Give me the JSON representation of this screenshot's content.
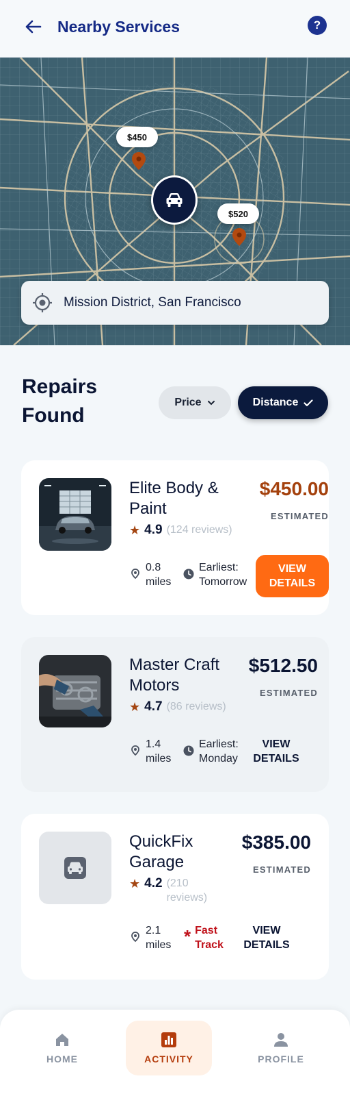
{
  "header": {
    "title": "Nearby Services",
    "back_icon": "arrow-left-icon",
    "help_icon": "question-icon",
    "help_label": "?"
  },
  "map": {
    "pins": [
      {
        "label": "$450"
      },
      {
        "label": "$520"
      }
    ],
    "center_icon": "car-icon",
    "location": "Mission District, San Francisco",
    "location_icon": "crosshair-icon"
  },
  "section": {
    "title": "Repairs Found",
    "filters": {
      "price": "Price",
      "distance": "Distance"
    }
  },
  "results": [
    {
      "name": "Elite Body & Paint",
      "rating": "4.9",
      "reviews": "(124 reviews)",
      "price": "$450.00",
      "price_color": "#a4410d",
      "estimated": "ESTIMATED",
      "distance": "0.8 miles",
      "availability": "Earliest: Tomorrow",
      "availability_icon": "clock-icon",
      "button": "VIEW DETAILS"
    },
    {
      "name": "Master Craft Motors",
      "rating": "4.7",
      "reviews": "(86 reviews)",
      "price": "$512.50",
      "price_color": "#0b1533",
      "estimated": "ESTIMATED",
      "distance": "1.4 miles",
      "availability": "Earliest: Monday",
      "availability_icon": "clock-icon",
      "button": "VIEW DETAILS"
    },
    {
      "name": "QuickFix Garage",
      "rating": "4.2",
      "reviews": "(210 reviews)",
      "price": "$385.00",
      "price_color": "#0b1533",
      "estimated": "ESTIMATED",
      "distance": "2.1 miles",
      "availability": "Fast Track",
      "availability_icon": "asterisk-icon",
      "availability_color": "#c0121b",
      "button": "VIEW DETAILS"
    }
  ],
  "nav": {
    "items": [
      {
        "label": "HOME",
        "icon": "home-icon"
      },
      {
        "label": "ACTIVITY",
        "icon": "activity-chart-icon",
        "active": true
      },
      {
        "label": "PROFILE",
        "icon": "person-icon"
      }
    ]
  },
  "colors": {
    "accent": "#ff6a13",
    "brand": "#152a86",
    "navy": "#0b1a3d"
  }
}
